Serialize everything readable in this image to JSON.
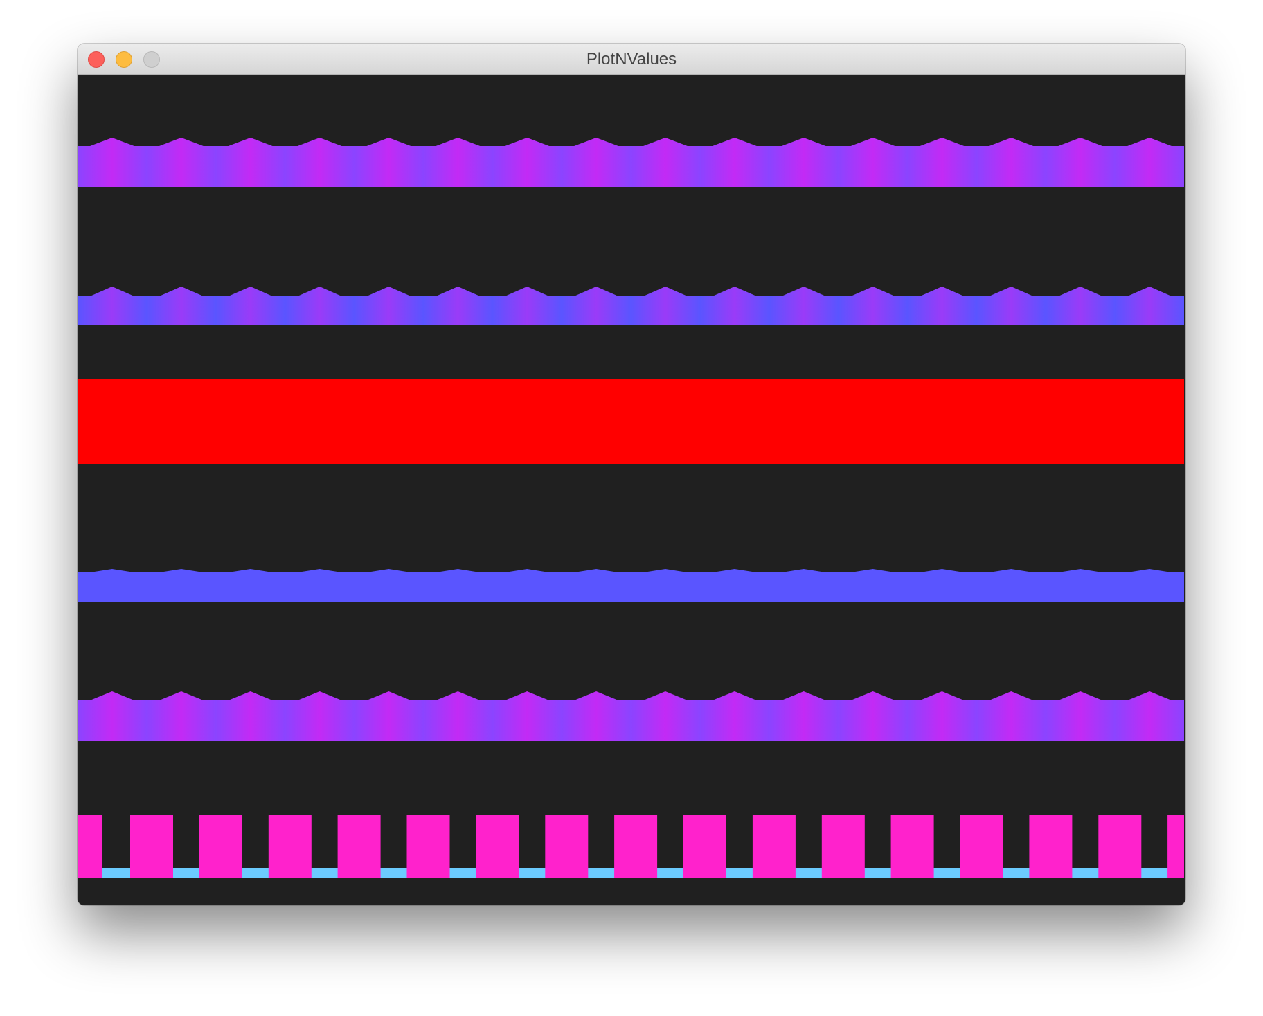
{
  "window": {
    "title": "PlotNValues",
    "controls": {
      "close": "close-button",
      "minimize": "minimize-button",
      "zoom": "zoom-button"
    }
  },
  "canvas": {
    "background": "#202020",
    "tracks": [
      {
        "kind": "wave",
        "waves": 16,
        "colors": [
          "#8b44ff",
          "#c32af5"
        ],
        "shading": "gradient"
      },
      {
        "kind": "wave",
        "waves": 16,
        "colors": [
          "#5a55ff",
          "#9a3bf8"
        ],
        "shading": "gradient"
      },
      {
        "kind": "solid",
        "colors": [
          "#ff0000"
        ]
      },
      {
        "kind": "wave",
        "waves": 16,
        "colors": [
          "#5a55ff",
          "#5a55ff"
        ],
        "shading": "flat"
      },
      {
        "kind": "wave",
        "waves": 16,
        "colors": [
          "#8b44ff",
          "#c32af5"
        ],
        "shading": "gradient"
      },
      {
        "kind": "pulse",
        "pulses": 16,
        "colors": [
          "#ff22cc",
          "#6ccbff"
        ]
      }
    ]
  }
}
